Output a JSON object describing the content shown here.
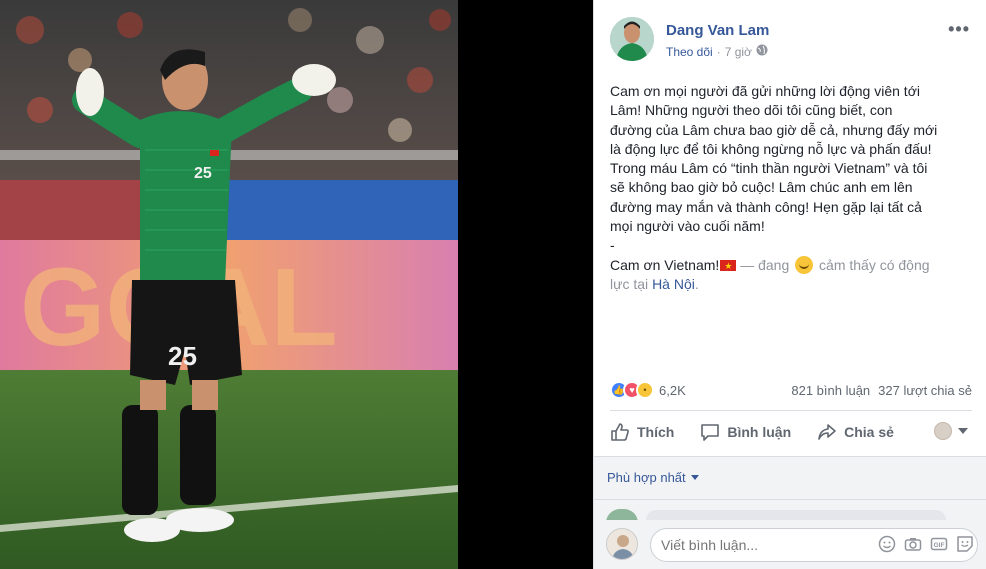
{
  "post": {
    "author": "Dang Van Lam",
    "follow": "Theo dõi",
    "separator": " · ",
    "time": "7 giờ",
    "more": "•••",
    "lines": [
      "Cam ơn mọi người đã gửi những lời động viên tới",
      "Lâm! Những người theo dõi tôi cũng biết, con",
      "đường của Lâm chưa bao giờ dễ cả, nhưng đấy mới",
      "là động lực để tôi không ngừng nỗ lực và phấn đấu!",
      "Trong máu Lâm có “tinh thần người Vietnam” và tôi",
      "sẽ không bao giờ bỏ cuộc! Lâm chúc anh em lên",
      "đường may mắn và thành công! Hẹn gặp lại tất cả",
      "mọi người vào cuối năm!",
      "-"
    ],
    "closing": "Cam ơn Vietnam!",
    "feeling_prefix": " — đang ",
    "feeling": "cảm thấy có động",
    "feeling2": "lực",
    "location_prefix": " tại ",
    "location": "Hà Nội",
    "location_suffix": "."
  },
  "stats": {
    "reactions": "6,2K",
    "comments": "821 bình luận",
    "shares": "327 lượt chia sẻ"
  },
  "actions": {
    "like": "Thích",
    "comment": "Bình luận",
    "share": "Chia sẻ"
  },
  "comments": {
    "sort_label": "Phù hợp nhất",
    "placeholder": "Viết bình luận..."
  },
  "photo": {
    "jersey_number": "25"
  },
  "colors": {
    "link": "#365899",
    "like": "#4080ff",
    "love": "#f25268",
    "jersey": "#1f8a4c"
  }
}
